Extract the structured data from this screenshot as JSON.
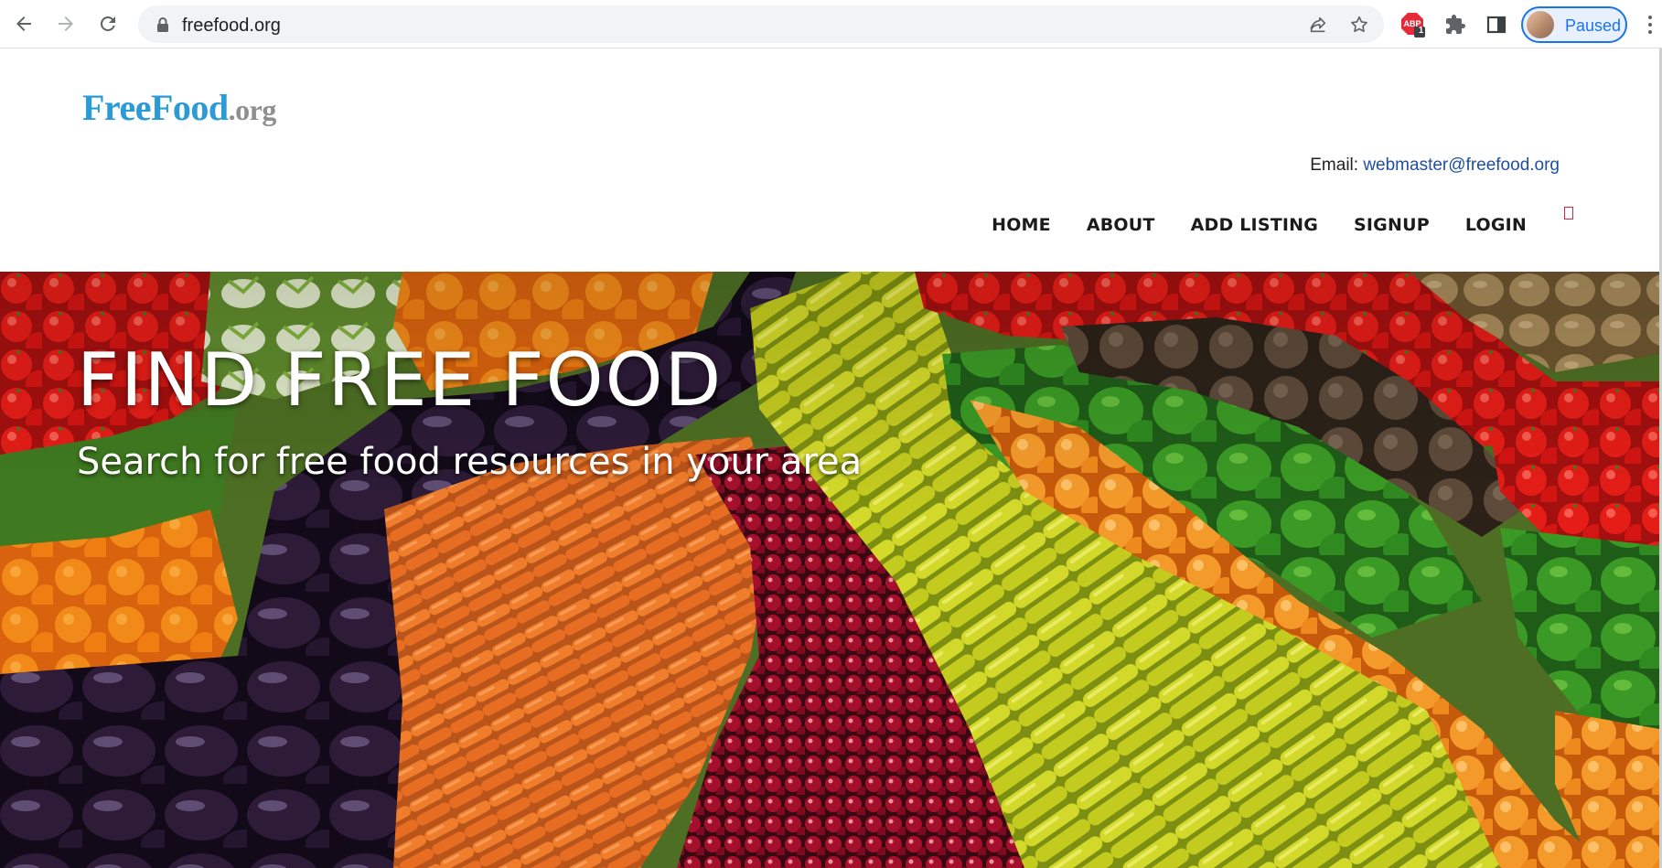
{
  "browser": {
    "url": "freefood.org",
    "profile_label": "Paused",
    "extension_badge": "1",
    "icons": [
      "back-arrow-icon",
      "forward-arrow-icon",
      "reload-icon",
      "lock-icon",
      "share-icon",
      "bookmark-star-icon",
      "adblock-icon",
      "extensions-puzzle-icon",
      "side-panel-icon",
      "more-menu-icon"
    ]
  },
  "site": {
    "logo_brand": "FreeFood",
    "logo_tld": ".org",
    "email_label": "Email:",
    "email_address": "webmaster@freefood.org",
    "nav": {
      "home": "HOME",
      "about": "ABOUT",
      "add_listing": "ADD LISTING",
      "signup": "SIGNUP",
      "login": "LOGIN"
    }
  },
  "hero": {
    "title": "FIND FREE FOOD",
    "subtitle": "Search for free food resources in your area"
  },
  "colors": {
    "brand_blue": "#2a9bd6",
    "tld_gray": "#8f8f8f",
    "link_blue": "#1f4fa0",
    "chrome_accent": "#1a73e8"
  }
}
